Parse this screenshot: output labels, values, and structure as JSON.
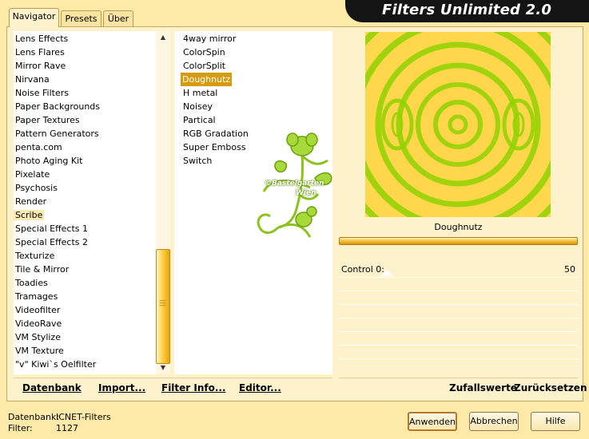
{
  "app": {
    "title": "Filters Unlimited 2.0"
  },
  "tabs": [
    {
      "label": "Navigator",
      "active": true
    },
    {
      "label": "Presets",
      "active": false
    },
    {
      "label": "Über",
      "active": false
    }
  ],
  "categories": [
    "Lens Effects",
    "Lens Flares",
    "Mirror Rave",
    "Nirvana",
    "Noise Filters",
    "Paper Backgrounds",
    "Paper Textures",
    "Pattern Generators",
    "penta.com",
    "Photo Aging Kit",
    "Pixelate",
    "Psychosis",
    "Render",
    "Scribe",
    "Special Effects 1",
    "Special Effects 2",
    "Texturize",
    "Tile & Mirror",
    "Toadies",
    "Tramages",
    "Videofilter",
    "VideoRave",
    "VM Stylize",
    "VM Texture",
    "\"v\" Kiwi`s Oelfilter"
  ],
  "selected_category": "Scribe",
  "filters": [
    "4way mirror",
    "ColorSpin",
    "ColorSplit",
    "Doughnutz",
    "H metal",
    "Noisey",
    "Partical",
    "RGB Gradation",
    "Super Emboss",
    "Switch"
  ],
  "selected_filter": "Doughnutz",
  "watermark": {
    "text1": "©Bastelgarten",
    "text2": "Wien"
  },
  "preview": {
    "filter_name": "Doughnutz",
    "colors": [
      "#ffd54a",
      "#8fd200"
    ]
  },
  "controls": [
    {
      "label": "Control 0:",
      "value": "50"
    }
  ],
  "bottom_left_buttons": {
    "datenbank": "Datenbank",
    "import": "Import...",
    "filter_info": "Filter Info...",
    "editor": "Editor..."
  },
  "bottom_right_buttons": {
    "random": "Zufallswerte",
    "reset": "Zurücksetzen"
  },
  "status": {
    "db_label": "Datenbank:",
    "db_value": "ICNET-Filters",
    "filter_label": "Filter:",
    "filter_value": "1127"
  },
  "dialog_buttons": {
    "apply": "Anwenden",
    "cancel": "Abbrechen",
    "help": "Hilfe"
  }
}
